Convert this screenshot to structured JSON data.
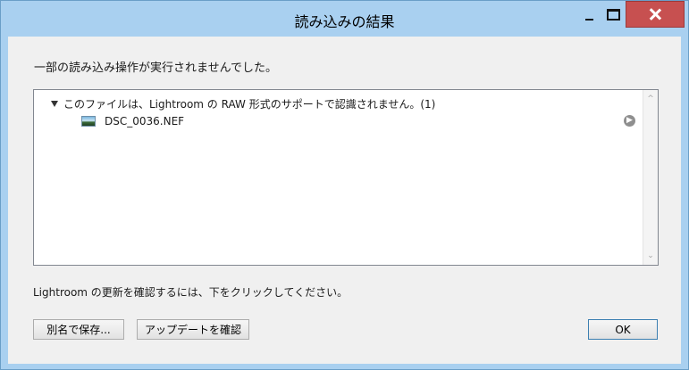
{
  "window": {
    "title": "読み込みの結果"
  },
  "dialog": {
    "message": "一部の読み込み操作が実行されませんでした。",
    "list": {
      "group_label": "このファイルは、Lightroom の RAW 形式のサポートで認識されません。(1)",
      "files": [
        {
          "name": "DSC_0036.NEF",
          "icon": "raw-image-thumbnail-icon"
        }
      ],
      "row_action_icon": "arrow-right-circle-icon"
    },
    "footer_text": "Lightroom の更新を確認するには、下をクリックしてください。",
    "buttons": {
      "rename": "別名で保存...",
      "check_update": "アップデートを確認",
      "ok": "OK"
    }
  },
  "colors": {
    "frame": "#a9d0f0",
    "close_button": "#c75050",
    "client": "#f0f0f0",
    "default_button_border": "#3c7fb1"
  }
}
